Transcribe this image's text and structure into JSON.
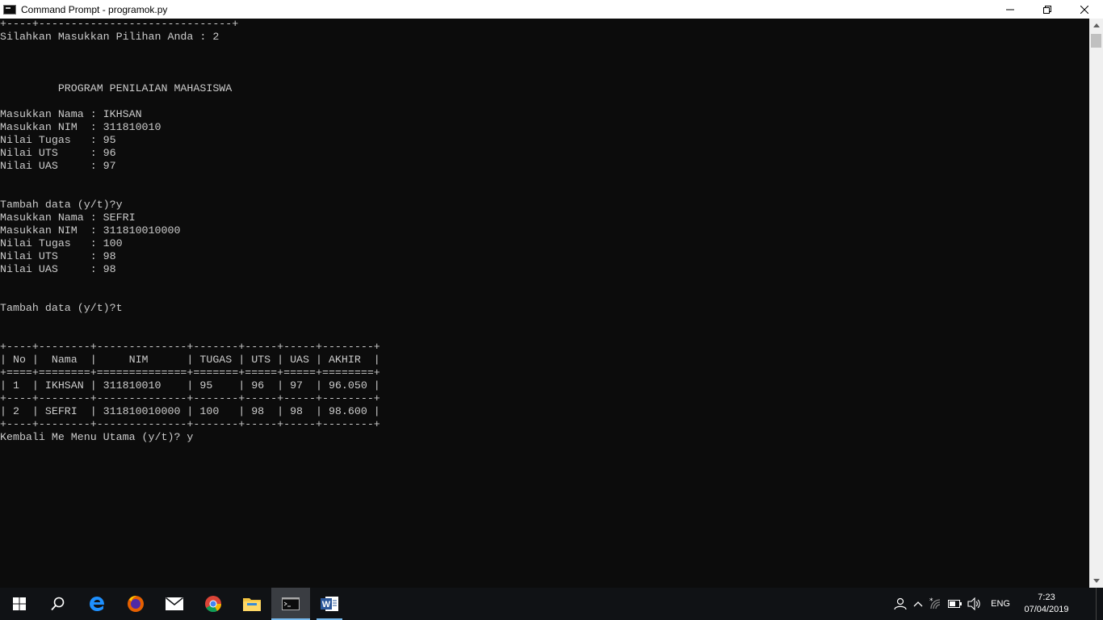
{
  "window": {
    "title": "Command Prompt - programok.py",
    "minimize_glyph": "—",
    "restore_glyph": "❐",
    "close_glyph": "✕"
  },
  "console": {
    "lines": [
      "+----+------------------------------+",
      "Silahkan Masukkan Pilihan Anda : 2",
      "",
      "",
      "",
      "         PROGRAM PENILAIAN MAHASISWA",
      "",
      "Masukkan Nama : IKHSAN",
      "Masukkan NIM  : 311810010",
      "Nilai Tugas   : 95",
      "Nilai UTS     : 96",
      "Nilai UAS     : 97",
      "",
      "",
      "Tambah data (y/t)?y",
      "Masukkan Nama : SEFRI",
      "Masukkan NIM  : 311810010000",
      "Nilai Tugas   : 100",
      "Nilai UTS     : 98",
      "Nilai UAS     : 98",
      "",
      "",
      "Tambah data (y/t)?t",
      "",
      "",
      "+----+--------+--------------+-------+-----+-----+--------+",
      "| No |  Nama  |     NIM      | TUGAS | UTS | UAS | AKHIR  |",
      "+====+========+==============+=======+=====+=====+========+",
      "| 1  | IKHSAN | 311810010    | 95    | 96  | 97  | 96.050 |",
      "+----+--------+--------------+-------+-----+-----+--------+",
      "| 2  | SEFRI  | 311810010000 | 100   | 98  | 98  | 98.600 |",
      "+----+--------+--------------+-------+-----+-----+--------+",
      "Kembali Me Menu Utama (y/t)? y"
    ]
  },
  "taskbar": {
    "apps": [
      {
        "name": "start",
        "icon": "windows-icon"
      },
      {
        "name": "search",
        "icon": "search-icon"
      },
      {
        "name": "edge",
        "icon": "edge-icon"
      },
      {
        "name": "firefox",
        "icon": "firefox-icon"
      },
      {
        "name": "mail",
        "icon": "mail-icon"
      },
      {
        "name": "chrome",
        "icon": "chrome-icon"
      },
      {
        "name": "file-explorer",
        "icon": "folder-icon"
      },
      {
        "name": "command-prompt",
        "icon": "cmd-icon"
      },
      {
        "name": "word",
        "icon": "word-icon"
      }
    ],
    "tray": {
      "language": "ENG",
      "time": "7:23",
      "date": "07/04/2019"
    }
  }
}
